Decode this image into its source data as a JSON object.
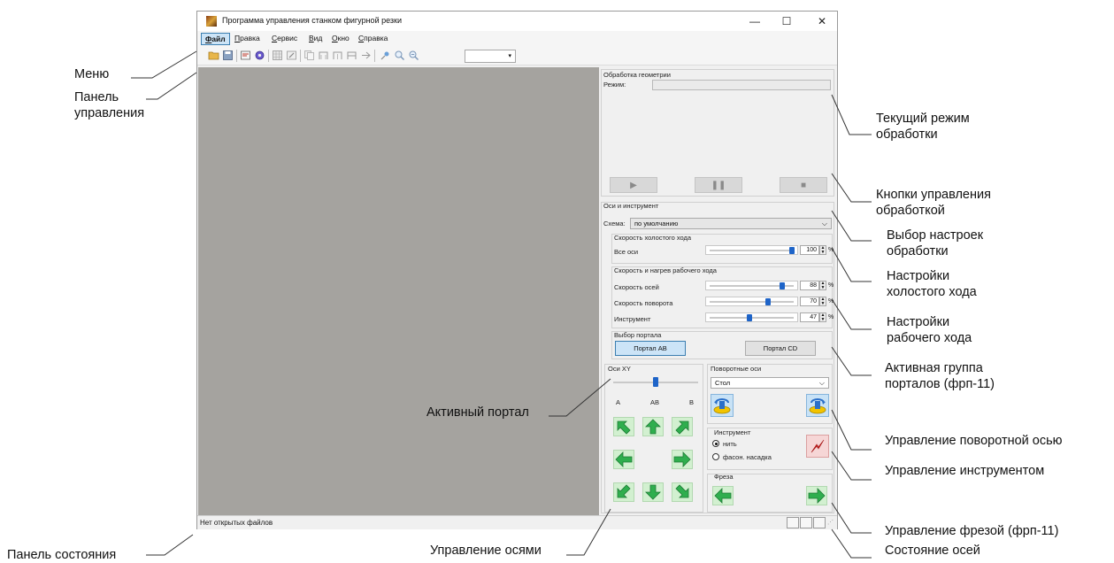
{
  "window": {
    "title": "Программа управления станком фигурной резки",
    "controls": {
      "minimize": "—",
      "maximize": "☐",
      "close": "✕"
    }
  },
  "menu": [
    {
      "mn": "Ф",
      "rest": "айл"
    },
    {
      "mn": "П",
      "rest": "равка"
    },
    {
      "mn": "С",
      "rest": "ервис"
    },
    {
      "mn": "В",
      "rest": "ид"
    },
    {
      "mn": "О",
      "rest": "кно"
    },
    {
      "mn": "С",
      "rest": "правка"
    }
  ],
  "toolbar": {
    "icons": [
      "open-folder-icon",
      "save-icon",
      "settings-icon",
      "gear-icon",
      "grid-icon",
      "edit-icon",
      "copy-icon",
      "portal-ab-icon",
      "portal-cd-icon",
      "portal-all-icon",
      "split-icon",
      "pointer-icon",
      "zoom-in-icon",
      "zoom-out-icon"
    ],
    "zoom_value": ""
  },
  "status": {
    "text": "Нет открытых файлов"
  },
  "panel": {
    "geometry": {
      "title": "Обработка геометрии",
      "mode_label": "Режим:",
      "mode_value": "",
      "buttons": {
        "play": "▶",
        "pause": "❚❚",
        "stop": "■"
      }
    },
    "axes": {
      "title": "Оси и инструмент",
      "scheme_label": "Схема:",
      "scheme_value": "по умолчанию",
      "idle": {
        "title": "Скорость холостого хода",
        "all_label": "Все оси",
        "all_value": "100",
        "all_level": 1.0
      },
      "work": {
        "title": "Скорость и нагрев рабочего хода",
        "axes_label": "Скорость осей",
        "axes_value": "88",
        "axes_level": 0.88,
        "rotation_label": "Скорость поворота",
        "rotation_value": "70",
        "rotation_level": 0.7,
        "tool_label": "Инструмент",
        "tool_value": "47",
        "tool_level": 0.47
      },
      "percent": "%"
    },
    "portal": {
      "title": "Выбор портала",
      "ab": "Портал AB",
      "cd": "Портал CD"
    },
    "xy": {
      "title": "Оси XY",
      "a": "A",
      "ab": "AB",
      "b": "B"
    },
    "rotary": {
      "title": "Поворотные оси",
      "value": "Стол"
    },
    "tool": {
      "title": "Инструмент",
      "wire": "нить",
      "nozzle": "фасон. насадка"
    },
    "mill": {
      "title": "Фреза"
    }
  },
  "annotations": {
    "menu": "Меню",
    "toolbar_l1": "Панель",
    "toolbar_l2": "управления",
    "status_bar": "Панель состояния",
    "axis_control": "Управление осями",
    "active_portal": "Активный портал",
    "mode_l1": "Текущий режим",
    "mode_l2": "обработки",
    "buttons_l1": "Кнопки управления",
    "buttons_l2": "обработкой",
    "scheme_l1": "Выбор настроек",
    "scheme_l2": "обработки",
    "idle_l1": "Настройки",
    "idle_l2": "холостого хода",
    "work_l1": "Настройки",
    "work_l2": "рабочего хода",
    "group_l1": "Активная группа",
    "group_l2": "порталов (фрп-11)",
    "rotary_control": "Управление поворотной осью",
    "tool_control": "Управление инструментом",
    "mill_control": "Управление фрезой (фрп-11)",
    "axes_state": "Состояние осей"
  }
}
